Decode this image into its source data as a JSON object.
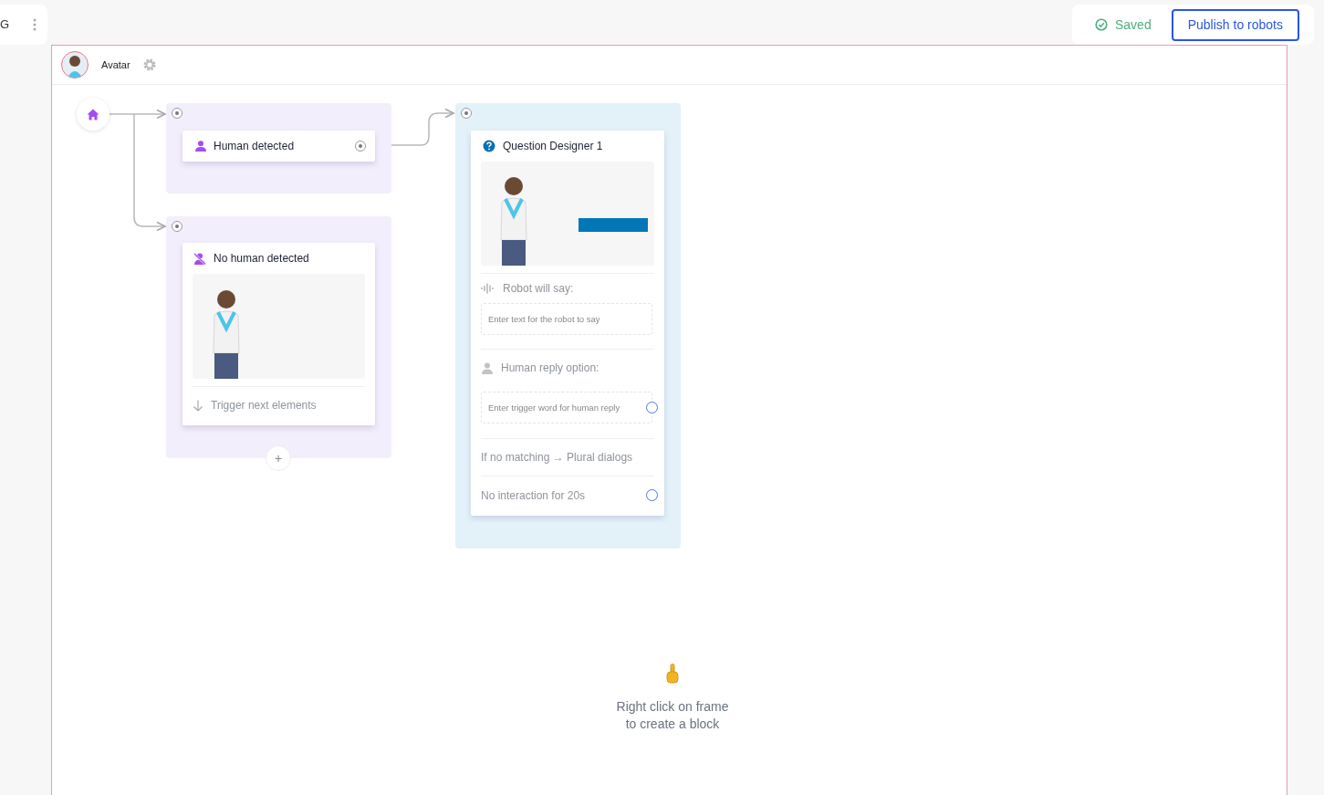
{
  "side_card": {
    "label": "G"
  },
  "save_status": {
    "label": "Saved"
  },
  "publish_button": {
    "label": "Publish to robots"
  },
  "frame": {
    "title": "Avatar"
  },
  "blocks": [
    {
      "kind": "trigger",
      "title": "Human detected"
    },
    {
      "kind": "trigger_image",
      "title": "No human detected",
      "footer": "Trigger next elements",
      "add_button": "+"
    },
    {
      "kind": "question",
      "title": "Question Designer 1",
      "say_label": "Robot will say:",
      "say_placeholder": "Enter text for the robot to say",
      "reply_label": "Human reply option:",
      "reply_placeholder": "Enter trigger word for human reply",
      "fallback": "If no matching → Plural dialogs",
      "timeout": "No interaction for 20s"
    }
  ],
  "hint": {
    "text": "Right click on frame\nto create a block"
  }
}
